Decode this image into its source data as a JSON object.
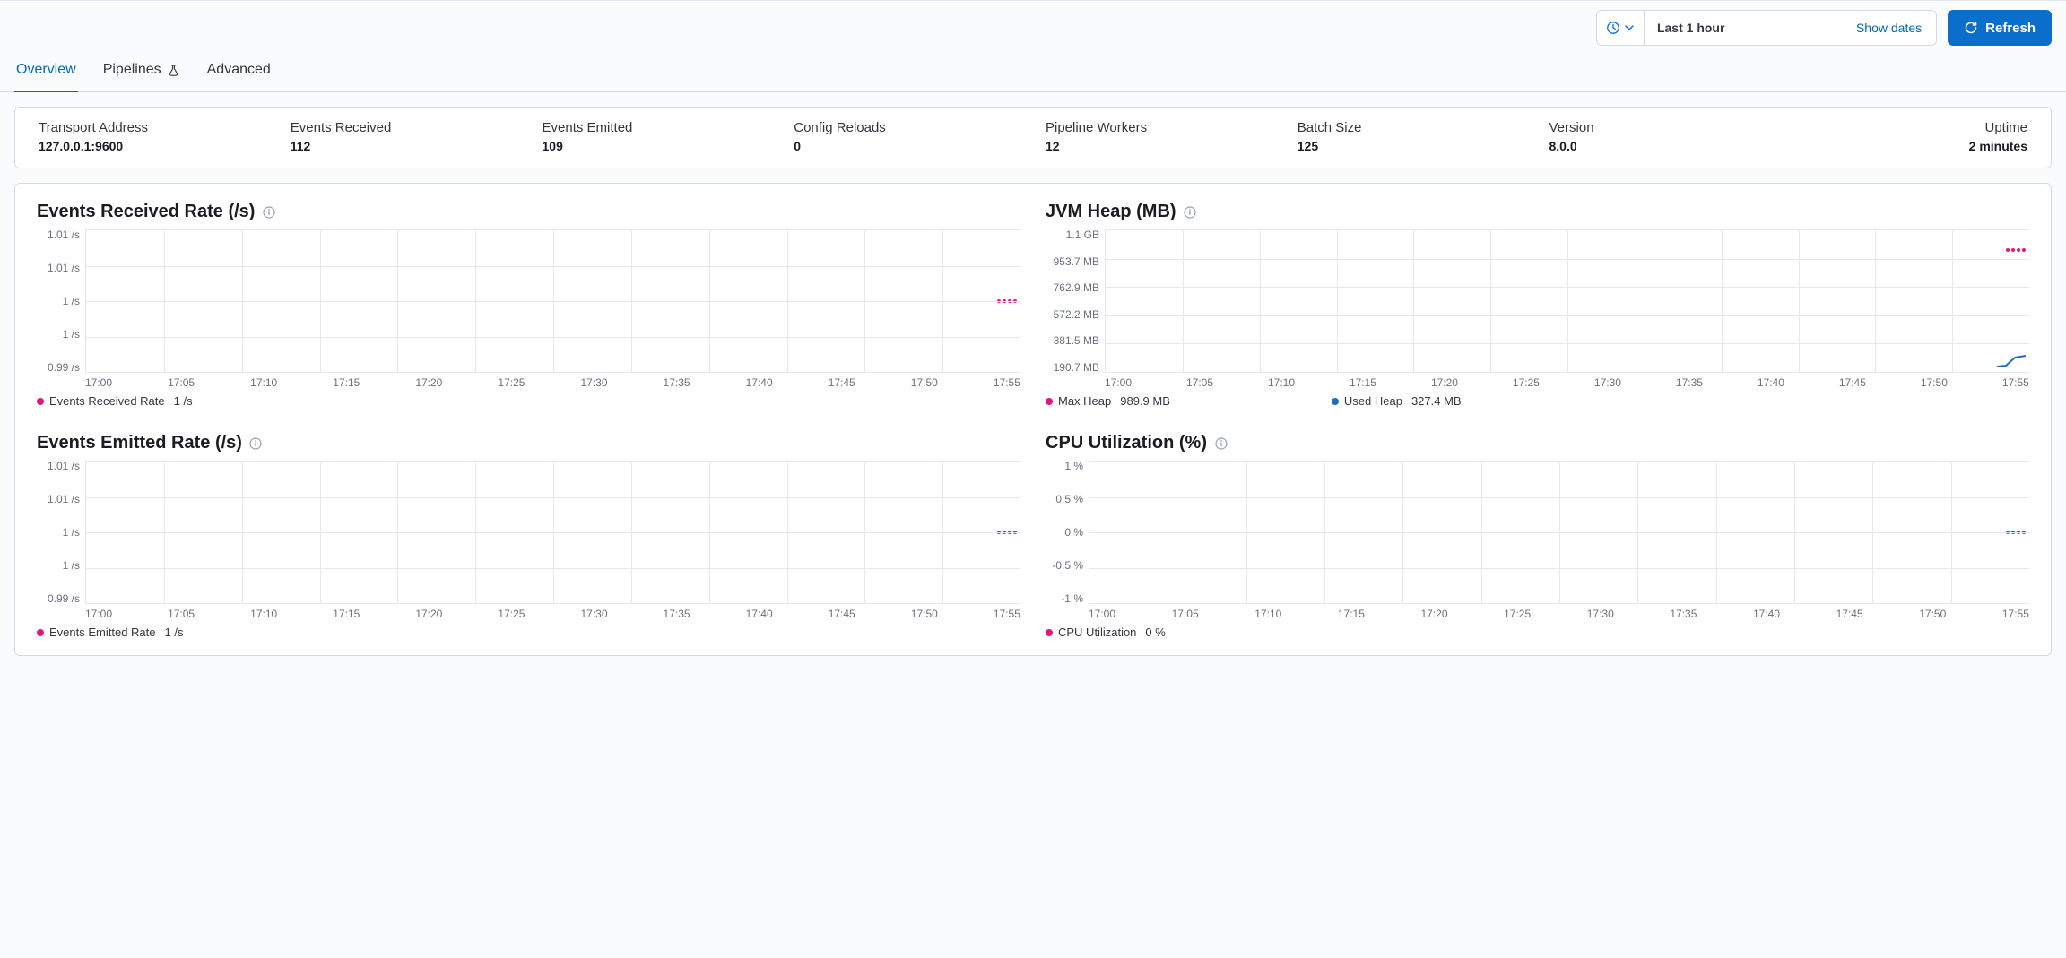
{
  "topbar": {
    "range_label": "Last 1 hour",
    "show_dates": "Show dates",
    "refresh": "Refresh"
  },
  "tabs": {
    "overview": "Overview",
    "pipelines": "Pipelines",
    "advanced": "Advanced"
  },
  "stats": {
    "transport_address": {
      "label": "Transport Address",
      "value": "127.0.0.1:9600"
    },
    "events_received": {
      "label": "Events Received",
      "value": "112"
    },
    "events_emitted": {
      "label": "Events Emitted",
      "value": "109"
    },
    "config_reloads": {
      "label": "Config Reloads",
      "value": "0"
    },
    "pipeline_workers": {
      "label": "Pipeline Workers",
      "value": "12"
    },
    "batch_size": {
      "label": "Batch Size",
      "value": "125"
    },
    "version": {
      "label": "Version",
      "value": "8.0.0"
    },
    "uptime": {
      "label": "Uptime",
      "value": "2 minutes"
    }
  },
  "time_ticks": [
    "17:00",
    "17:05",
    "17:10",
    "17:15",
    "17:20",
    "17:25",
    "17:30",
    "17:35",
    "17:40",
    "17:45",
    "17:50",
    "17:55"
  ],
  "charts": {
    "events_received": {
      "title": "Events Received Rate (/s)",
      "y_ticks": [
        "1.01 /s",
        "1.01 /s",
        "1 /s",
        "1 /s",
        "0.99 /s"
      ],
      "legend_name": "Events Received Rate",
      "legend_value": "1 /s"
    },
    "events_emitted": {
      "title": "Events Emitted Rate (/s)",
      "y_ticks": [
        "1.01 /s",
        "1.01 /s",
        "1 /s",
        "1 /s",
        "0.99 /s"
      ],
      "legend_name": "Events Emitted Rate",
      "legend_value": "1 /s"
    },
    "jvm_heap": {
      "title": "JVM Heap (MB)",
      "y_ticks": [
        "1.1 GB",
        "953.7 MB",
        "762.9 MB",
        "572.2 MB",
        "381.5 MB",
        "190.7 MB"
      ],
      "legend_max_name": "Max Heap",
      "legend_max_value": "989.9 MB",
      "legend_used_name": "Used Heap",
      "legend_used_value": "327.4 MB"
    },
    "cpu": {
      "title": "CPU Utilization (%)",
      "y_ticks": [
        "1 %",
        "0.5 %",
        "0 %",
        "-0.5 %",
        "-1 %"
      ],
      "legend_name": "CPU Utilization",
      "legend_value": "0 %"
    }
  },
  "chart_data": [
    {
      "id": "events_received_rate",
      "type": "line",
      "title": "Events Received Rate (/s)",
      "xlabel": "",
      "ylabel": "/s",
      "ylim": [
        0.99,
        1.01
      ],
      "x": [
        "17:56",
        "17:57",
        "17:58",
        "17:59"
      ],
      "series": [
        {
          "name": "Events Received Rate",
          "values": [
            1,
            1,
            1,
            1
          ],
          "color": "#e7157b"
        }
      ]
    },
    {
      "id": "jvm_heap",
      "type": "line",
      "title": "JVM Heap (MB)",
      "xlabel": "",
      "ylabel": "MB",
      "ylim": [
        190.7,
        1126.4
      ],
      "x": [
        "17:56",
        "17:57",
        "17:58",
        "17:59"
      ],
      "series": [
        {
          "name": "Max Heap",
          "values": [
            989.9,
            989.9,
            989.9,
            989.9
          ],
          "color": "#e7157b"
        },
        {
          "name": "Used Heap",
          "values": [
            250,
            260,
            310,
            327.4
          ],
          "color": "#1e6fc0"
        }
      ]
    },
    {
      "id": "events_emitted_rate",
      "type": "line",
      "title": "Events Emitted Rate (/s)",
      "xlabel": "",
      "ylabel": "/s",
      "ylim": [
        0.99,
        1.01
      ],
      "x": [
        "17:56",
        "17:57",
        "17:58",
        "17:59"
      ],
      "series": [
        {
          "name": "Events Emitted Rate",
          "values": [
            1,
            1,
            1,
            1
          ],
          "color": "#e7157b"
        }
      ]
    },
    {
      "id": "cpu_utilization",
      "type": "line",
      "title": "CPU Utilization (%)",
      "xlabel": "",
      "ylabel": "%",
      "ylim": [
        -1,
        1
      ],
      "x": [
        "17:56",
        "17:57",
        "17:58",
        "17:59"
      ],
      "series": [
        {
          "name": "CPU Utilization",
          "values": [
            0,
            0,
            0,
            0
          ],
          "color": "#e7157b"
        }
      ]
    }
  ]
}
